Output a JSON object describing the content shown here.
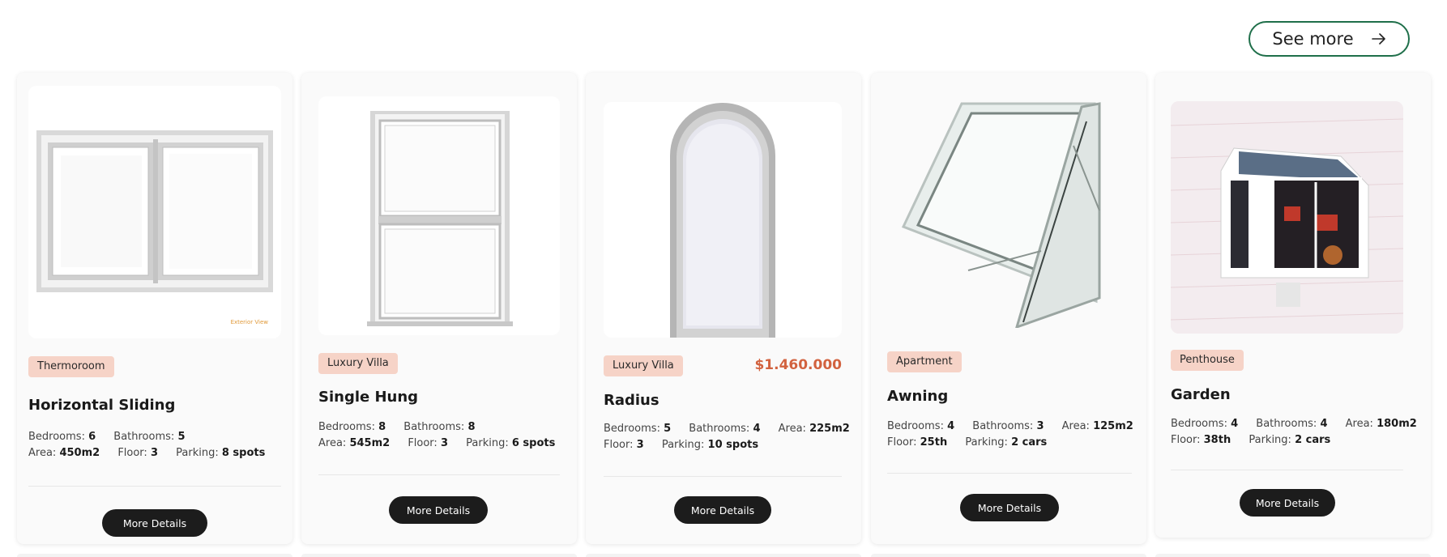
{
  "see_more": {
    "label": "See more"
  },
  "cards": [
    {
      "tag": "Thermoroom",
      "title": "Horizontal Sliding",
      "price": "",
      "photo_caption": "Exterior View",
      "specs": {
        "bedrooms_label": "Bedrooms:",
        "bedrooms": "6",
        "bathrooms_label": "Bathrooms:",
        "bathrooms": "5",
        "area_label": "Area:",
        "area": "450m2",
        "floor_label": "Floor:",
        "floor": "3",
        "parking_label": "Parking:",
        "parking": "8 spots"
      },
      "button": "More Details"
    },
    {
      "tag": "Luxury Villa",
      "title": "Single Hung",
      "price": "",
      "specs": {
        "bedrooms_label": "Bedrooms:",
        "bedrooms": "8",
        "bathrooms_label": "Bathrooms:",
        "bathrooms": "8",
        "area_label": "Area:",
        "area": "545m2",
        "floor_label": "Floor:",
        "floor": "3",
        "parking_label": "Parking:",
        "parking": "6 spots"
      },
      "button": "More Details"
    },
    {
      "tag": "Luxury Villa",
      "title": "Radius",
      "price": "$1.460.000",
      "specs": {
        "bedrooms_label": "Bedrooms:",
        "bedrooms": "5",
        "bathrooms_label": "Bathrooms:",
        "bathrooms": "4",
        "area_label": "Area:",
        "area": "225m2",
        "floor_label": "Floor:",
        "floor": "3",
        "parking_label": "Parking:",
        "parking": "10 spots"
      },
      "button": "More Details"
    },
    {
      "tag": "Apartment",
      "title": "Awning",
      "price": "",
      "specs": {
        "bedrooms_label": "Bedrooms:",
        "bedrooms": "4",
        "bathrooms_label": "Bathrooms:",
        "bathrooms": "3",
        "area_label": "Area:",
        "area": "125m2",
        "floor_label": "Floor:",
        "floor": "25th",
        "parking_label": "Parking:",
        "parking": "2 cars"
      },
      "button": "More Details"
    },
    {
      "tag": "Penthouse",
      "title": "Garden",
      "price": "",
      "specs": {
        "bedrooms_label": "Bedrooms:",
        "bedrooms": "4",
        "bathrooms_label": "Bathrooms:",
        "bathrooms": "4",
        "area_label": "Area:",
        "area": "180m2",
        "floor_label": "Floor:",
        "floor": "38th",
        "parking_label": "Parking:",
        "parking": "2 cars"
      },
      "button": "More Details"
    }
  ]
}
